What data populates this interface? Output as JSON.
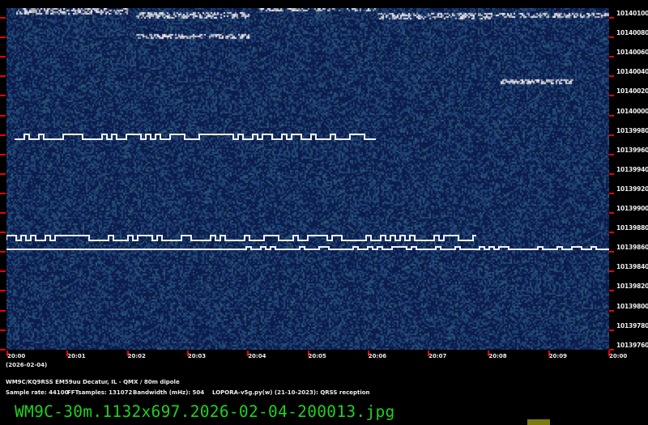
{
  "y_axis": {
    "labels": [
      "10140100",
      "10140080",
      "10140060",
      "10140040",
      "10140020",
      "10140000",
      "10139980",
      "10139960",
      "10139940",
      "10139920",
      "10139900",
      "10139880",
      "10139860",
      "10139840",
      "10139820",
      "10139800",
      "10139780",
      "10139760"
    ]
  },
  "x_axis": {
    "labels": [
      "20:00",
      "20:01",
      "20:02",
      "20:03",
      "20:04",
      "20:05",
      "20:06",
      "20:07",
      "20:08",
      "20:09",
      "20:00"
    ],
    "date": "(2026-02-04)"
  },
  "info": {
    "station": "WM9C/KQ9RSS EM59uu Decatur, IL - QMX / 80m dipole",
    "sample_rate": "Sample rate: 44100",
    "fft": "FFTsamples: 131072",
    "bandwidth": "Bandwidth (mHz): 504",
    "software": "LOPORA-v5g.py(w) (21-10-2023): QRSS reception"
  },
  "filename": "WM9C-30m.1132x697.2026-02-04-200013.jpg",
  "colors": {
    "background": "#0a1a4a",
    "tick": "#ee0000",
    "filename": "#1ed21e"
  }
}
